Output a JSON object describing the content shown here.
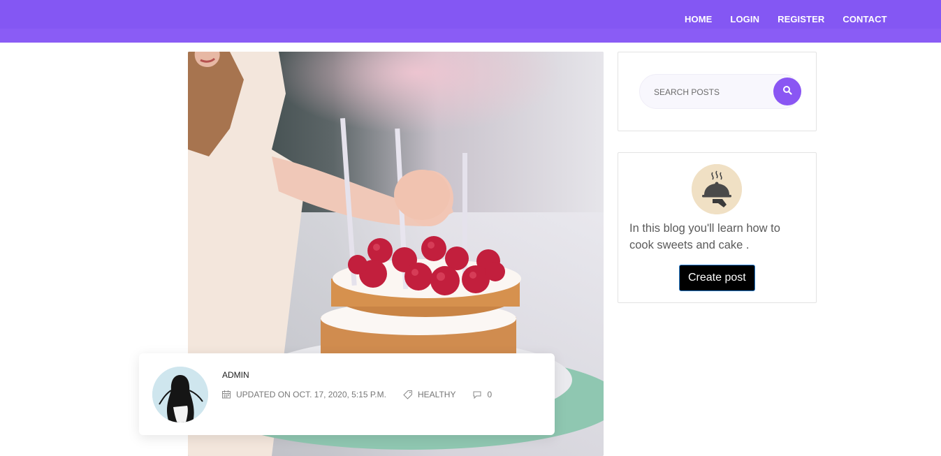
{
  "nav": {
    "items": [
      {
        "label": "HOME"
      },
      {
        "label": "LOGIN"
      },
      {
        "label": "REGISTER"
      },
      {
        "label": "CONTACT"
      }
    ]
  },
  "colors": {
    "header": "#8a5cf5",
    "accent": "#8a56f3",
    "button": "#000000"
  },
  "post": {
    "author": "ADMIN",
    "updated": "UPDATED ON OCT. 17, 2020, 5:15 P.M.",
    "category": "HEALTHY",
    "comments": "0"
  },
  "sidebar": {
    "search": {
      "placeholder": "SEARCH POSTS",
      "value": ""
    },
    "about": {
      "text": "In this blog you'll learn how to cook sweets and cake .",
      "button_label": "Create post"
    }
  },
  "icons": {
    "search": "search-icon",
    "calendar": "calendar-icon",
    "tag": "tag-icon",
    "comment": "comment-icon",
    "cloche": "serving-cloche-icon"
  }
}
